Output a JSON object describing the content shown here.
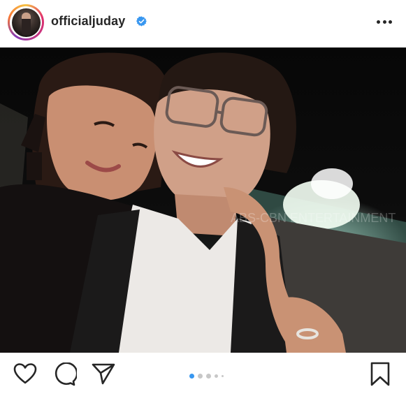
{
  "post": {
    "username": "officialjuday",
    "verified": true
  },
  "icons": {
    "like": "heart-icon",
    "comment": "comment-icon",
    "share": "send-icon",
    "save": "bookmark-icon",
    "more": "more-options-icon",
    "verified": "verified-badge-icon"
  },
  "carousel": {
    "total_dots": 5,
    "active_index": 0
  },
  "photo": {
    "watermark_text": "ABS-CBN ENTERTAINMENT"
  },
  "colors": {
    "accent_blue": "#3897f0",
    "text": "#262626",
    "dot_inactive": "#c7c7c7"
  }
}
